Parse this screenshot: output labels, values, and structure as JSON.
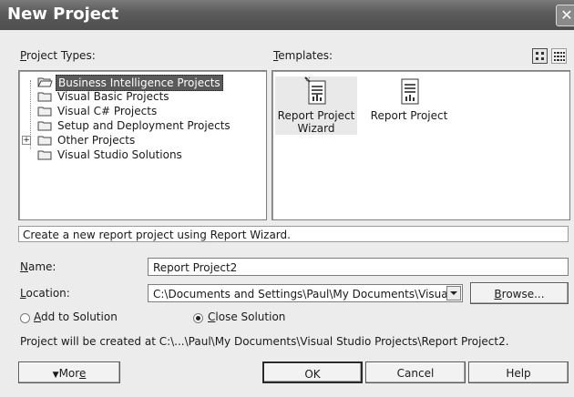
{
  "window": {
    "title": "New Project",
    "close_glyph": "✕"
  },
  "project_types": {
    "label_accel": "P",
    "label_rest": "roject Types:",
    "items": [
      {
        "label": "Business Intelligence Projects",
        "selected": true,
        "expander": ""
      },
      {
        "label": "Visual Basic Projects",
        "selected": false,
        "expander": ""
      },
      {
        "label": "Visual C# Projects",
        "selected": false,
        "expander": ""
      },
      {
        "label": "Setup and Deployment Projects",
        "selected": false,
        "expander": ""
      },
      {
        "label": "Other Projects",
        "selected": false,
        "expander": "+"
      },
      {
        "label": "Visual Studio Solutions",
        "selected": false,
        "expander": ""
      }
    ]
  },
  "templates": {
    "label_accel": "T",
    "label_rest": "emplates:",
    "items": [
      {
        "label": "Report Project Wizard",
        "icon": "report-wizard-icon",
        "selected": true
      },
      {
        "label": "Report Project",
        "icon": "report-project-icon",
        "selected": false
      }
    ]
  },
  "description": "Create a new report project using Report Wizard.",
  "name": {
    "label_accel": "N",
    "label_rest": "ame:",
    "value": "Report Project2"
  },
  "location": {
    "label_accel": "L",
    "label_rest": "ocation:",
    "value": "C:\\Documents and Settings\\Paul\\My Documents\\Visual S",
    "browse_pre": "",
    "browse_accel": "B",
    "browse_rest": "rowse..."
  },
  "options": {
    "add_accel": "A",
    "add_rest": "dd to Solution",
    "close_accel": "C",
    "close_rest": "lose Solution",
    "selected": "close"
  },
  "path_note": "Project will be created at C:\\...\\Paul\\My Documents\\Visual Studio Projects\\Report Project2.",
  "buttons": {
    "more_arrow": "▼",
    "more_pre": "Mor",
    "more_accel": "e",
    "ok": "OK",
    "cancel": "Cancel",
    "help": "Help"
  },
  "colors": {
    "titlebar": "#5c5c5c",
    "selection": "#5a5a5a",
    "dialog": "#ececec"
  }
}
